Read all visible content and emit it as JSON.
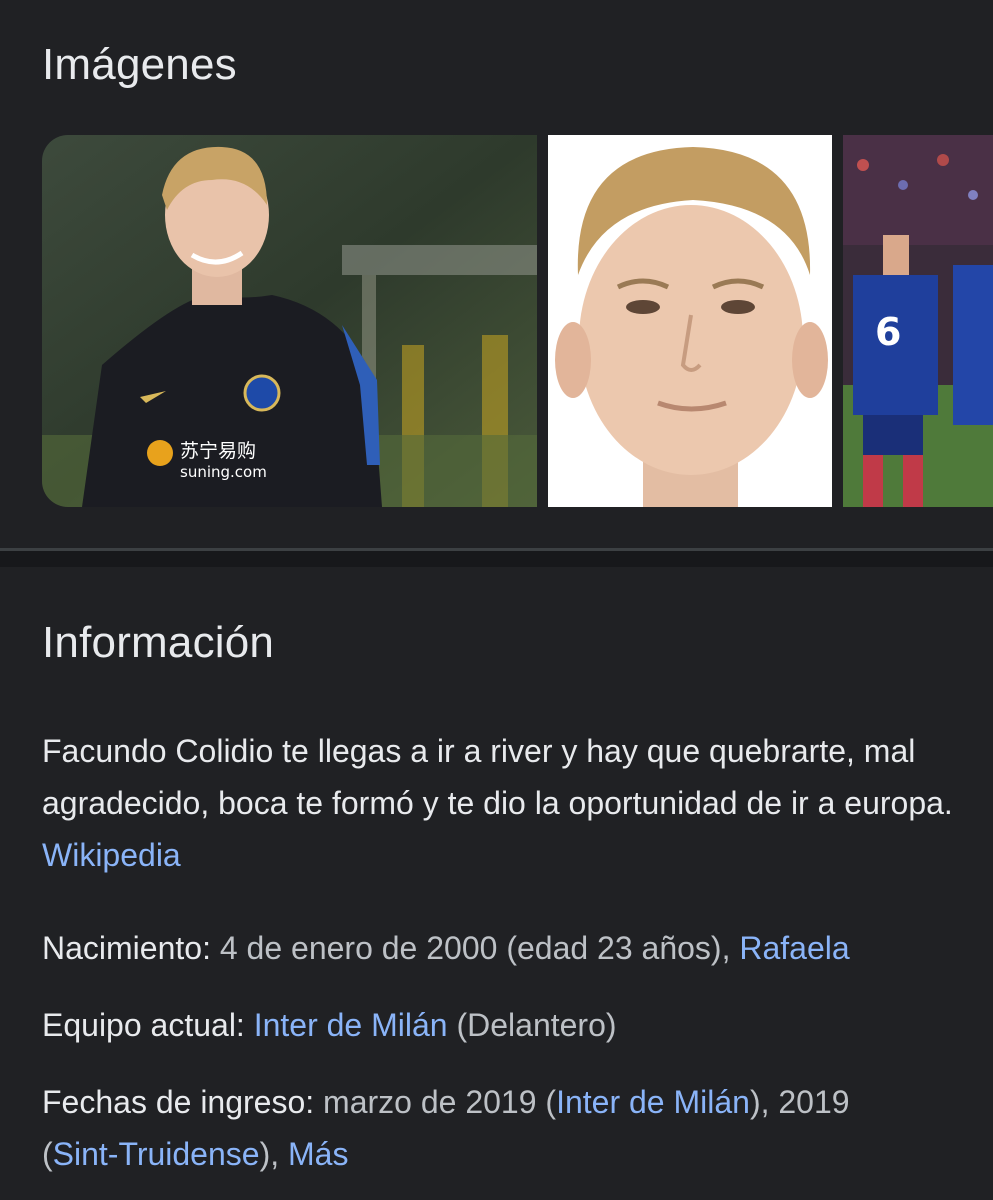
{
  "images": {
    "title": "Imágenes",
    "thumbs": [
      {
        "icon": "player-training-photo",
        "caption": "苏宁易购",
        "caption2": "suning.com"
      },
      {
        "icon": "player-portrait-photo"
      },
      {
        "icon": "match-celebration-photo",
        "shirt_number": "6"
      }
    ]
  },
  "info": {
    "title": "Información",
    "description": "Facundo Colidio te llegas a ir a river y hay que quebrarte, mal agradecido, boca te formó y te dio la oportunidad de ir a europa.",
    "source_link": "Wikipedia",
    "facts": {
      "birth": {
        "label": "Nacimiento:",
        "value": "4 de enero de 2000 (edad 23 años),",
        "link": "Rafaela"
      },
      "team": {
        "label": "Equipo actual:",
        "link": "Inter de Milán",
        "value": "(Delantero)"
      },
      "dates": {
        "label": "Fechas de ingreso:",
        "value1": "marzo de 2019 (",
        "link1": "Inter de Milán",
        "value2": "), 2019",
        "value3": "(",
        "link2": "Sint-Truidense",
        "value4": "),",
        "more": "Más"
      }
    }
  },
  "colors": {
    "background": "#202124",
    "text": "#e8eaed",
    "muted": "#bdc1c6",
    "link": "#8ab4f8"
  }
}
